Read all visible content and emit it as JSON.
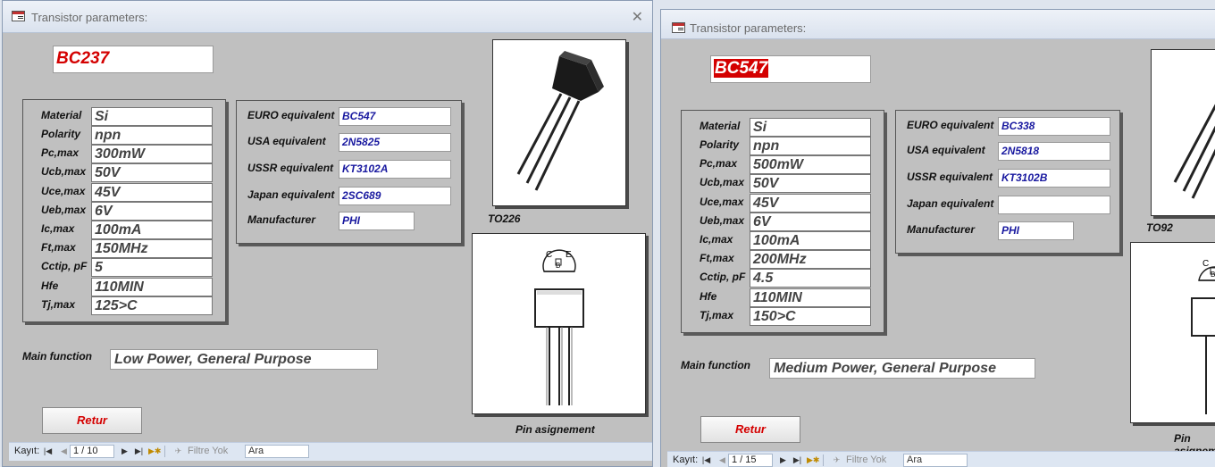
{
  "windows": [
    {
      "title": "Transistor parameters:",
      "close_glyph": "✕",
      "transistor_name": "BC237",
      "params": [
        {
          "label": "Material",
          "value": "Si"
        },
        {
          "label": "Polarity",
          "value": "npn"
        },
        {
          "label": "Pc,max",
          "value": "300mW"
        },
        {
          "label": "Ucb,max",
          "value": "50V"
        },
        {
          "label": "Uce,max",
          "value": "45V"
        },
        {
          "label": "Ueb,max",
          "value": "6V"
        },
        {
          "label": "Ic,max",
          "value": "100mA"
        },
        {
          "label": "Ft,max",
          "value": "150MHz"
        },
        {
          "label": "Cctip, pF",
          "value": "5"
        },
        {
          "label": "Hfe",
          "value": "110MIN"
        },
        {
          "label": "Tj,max",
          "value": "125>C"
        }
      ],
      "equivalents": [
        {
          "label": "EURO equivalent",
          "value": "BC547"
        },
        {
          "label": "USA equivalent",
          "value": "2N5825"
        },
        {
          "label": "USSR equivalent",
          "value": "KT3102A"
        },
        {
          "label": "Japan equivalent",
          "value": "2SC689"
        },
        {
          "label": "Manufacturer",
          "value": "PHI"
        }
      ],
      "package_label": "TO226",
      "pin_labels": {
        "c": "C",
        "b": "B",
        "e": "E"
      },
      "pin_caption": "Pin asignement",
      "main_function_label": "Main function",
      "main_function": "Low Power, General Purpose",
      "return_button": "Retur",
      "nav": {
        "record_label": "Kayıt:",
        "record": "1 / 10",
        "filter": "Filtre Yok",
        "search": "Ara"
      }
    },
    {
      "title": "Transistor parameters:",
      "transistor_name": "BC547",
      "params": [
        {
          "label": "Material",
          "value": "Si"
        },
        {
          "label": "Polarity",
          "value": "npn"
        },
        {
          "label": "Pc,max",
          "value": "500mW"
        },
        {
          "label": "Ucb,max",
          "value": "50V"
        },
        {
          "label": "Uce,max",
          "value": "45V"
        },
        {
          "label": "Ueb,max",
          "value": "6V"
        },
        {
          "label": "Ic,max",
          "value": "100mA"
        },
        {
          "label": "Ft,max",
          "value": "200MHz"
        },
        {
          "label": "Cctip, pF",
          "value": "4.5"
        },
        {
          "label": "Hfe",
          "value": "110MIN"
        },
        {
          "label": "Tj,max",
          "value": "150>C"
        }
      ],
      "equivalents": [
        {
          "label": "EURO equivalent",
          "value": "BC338"
        },
        {
          "label": "USA equivalent",
          "value": "2N5818"
        },
        {
          "label": "USSR equivalent",
          "value": "KT3102B"
        },
        {
          "label": "Japan equivalent",
          "value": ""
        },
        {
          "label": "Manufacturer",
          "value": "PHI"
        }
      ],
      "package_label": "TO92",
      "pin_labels": {
        "c": "C",
        "b": "B",
        "e": "E"
      },
      "pin_caption": "Pin asignement",
      "main_function_label": "Main function",
      "main_function": "Medium Power, General Purpose",
      "return_button": "Retur",
      "nav": {
        "record_label": "Kayıt:",
        "record": "1 / 15",
        "filter": "Filtre Yok",
        "search": "Ara"
      }
    }
  ],
  "colors": {
    "name_red": "#d40000",
    "equiv_blue": "#1a1aa0",
    "form_gray": "#c0c0c0"
  }
}
